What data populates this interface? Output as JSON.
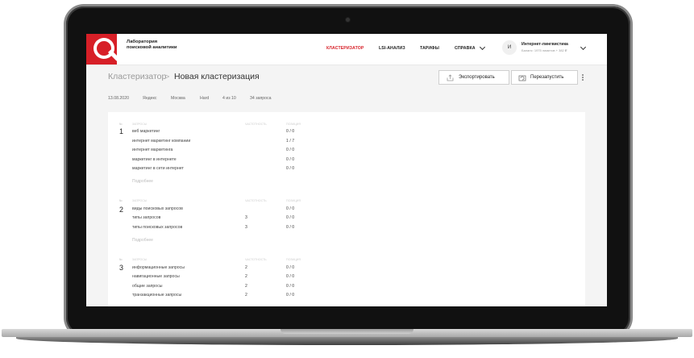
{
  "header": {
    "brand": "Лаборатория поисковой аналитики",
    "nav": [
      "КЛАСТЕРИЗАТОР",
      "LSI-АНАЛИЗ",
      "ТАРИФЫ",
      "СПРАВКА"
    ],
    "avatar_letter": "И",
    "account_name": "Интернет-лингвистика",
    "account_balance": "Баланс: 1975 лимитов + 382 ₽",
    "accent": "#d71f27"
  },
  "breadcrumb": {
    "root": "Кластеризатор",
    "sep": ">",
    "current": "Новая кластеризация"
  },
  "toolbar": {
    "export_label": "Экспортировать",
    "restart_label": "Перезапустить"
  },
  "meta": [
    "13.08.2020",
    "Яндекс",
    "Москва",
    "Hard",
    "4 из 10",
    "34 запроса"
  ],
  "columns": {
    "group": "№",
    "query": "ЗАПРОСЫ",
    "freq": "ЧАСТОТНОСТЬ",
    "pos": "ПОЗИЦИЯ"
  },
  "more_label": "Подробнее",
  "groups": [
    {
      "num": "1",
      "rows": [
        {
          "q": "веб маркетинг",
          "f": "",
          "p": "0 / 0"
        },
        {
          "q": "интернет маркетинг компании",
          "f": "",
          "p": "1 / 7"
        },
        {
          "q": "интернет маркетинга",
          "f": "",
          "p": "0 / 0"
        },
        {
          "q": "маркетинг в интернете",
          "f": "",
          "p": "0 / 0"
        },
        {
          "q": "маркетинг в сети интернет",
          "f": "",
          "p": "0 / 0"
        }
      ]
    },
    {
      "num": "2",
      "rows": [
        {
          "q": "виды поисковых запросов",
          "f": "",
          "p": "0 / 0"
        },
        {
          "q": "типы запросов",
          "f": "3",
          "p": "0 / 0"
        },
        {
          "q": "типы поисковых запросов",
          "f": "3",
          "p": "0 / 0"
        }
      ]
    },
    {
      "num": "3",
      "rows": [
        {
          "q": "информационные запросы",
          "f": "2",
          "p": "0 / 0"
        },
        {
          "q": "навигационные запросы",
          "f": "2",
          "p": "0 / 0"
        },
        {
          "q": "общие запросы",
          "f": "2",
          "p": "0 / 0"
        },
        {
          "q": "транзакционные запросы",
          "f": "2",
          "p": "0 / 0"
        }
      ]
    }
  ]
}
